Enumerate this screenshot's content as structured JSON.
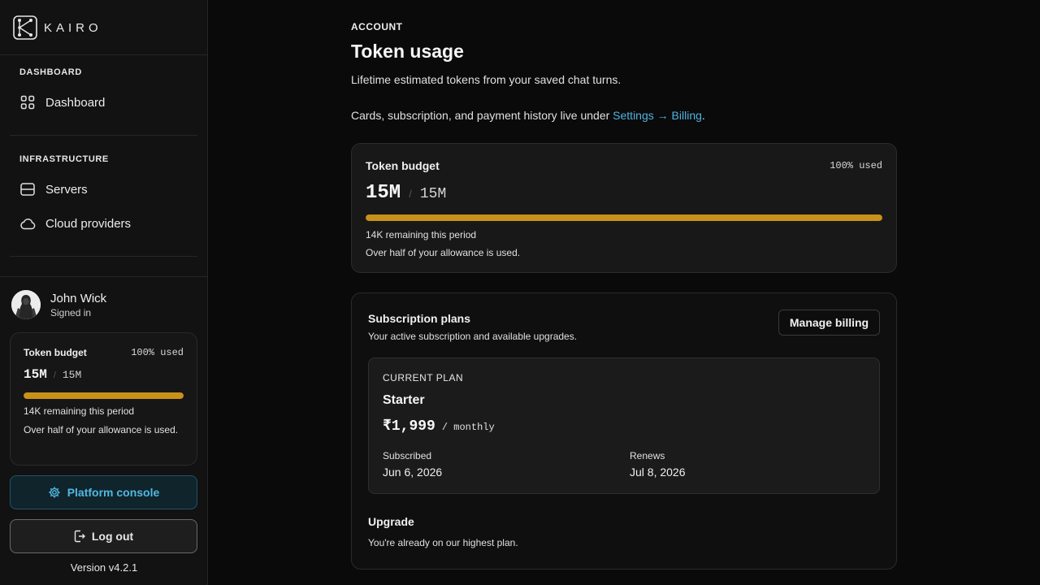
{
  "brand": {
    "name": "KAIRO"
  },
  "sidebar": {
    "sections": [
      {
        "title": "DASHBOARD",
        "items": [
          {
            "label": "Dashboard",
            "icon": "grid-icon"
          }
        ]
      },
      {
        "title": "INFRASTRUCTURE",
        "items": [
          {
            "label": "Servers",
            "icon": "server-icon"
          },
          {
            "label": "Cloud providers",
            "icon": "cloud-icon"
          }
        ]
      }
    ],
    "user": {
      "name": "John Wick",
      "status": "Signed in"
    },
    "budget": {
      "title": "Token budget",
      "percent_label": "100% used",
      "used": "15M",
      "separator": "/",
      "total": "15M",
      "progress": 1.0,
      "remaining": "14K remaining this period",
      "note": "Over half of your allowance is used."
    },
    "console_button": "Platform console",
    "logout_button": "Log out",
    "version": "Version v4.2.1"
  },
  "main": {
    "eyebrow": "ACCOUNT",
    "title": "Token usage",
    "subtitle": "Lifetime estimated tokens from your saved chat turns.",
    "billing_text": "Cards, subscription, and payment history live under",
    "billing_link": "Settings → Billing",
    "billing_end": ".",
    "budget": {
      "title": "Token budget",
      "percent_label": "100% used",
      "used": "15M",
      "separator": "/",
      "total": "15M",
      "progress": 1.0,
      "remaining": "14K remaining this period",
      "note": "Over half of your allowance is used."
    },
    "subscription": {
      "title": "Subscription plans",
      "subtitle": "Your active subscription and available upgrades.",
      "manage_button": "Manage billing",
      "plan": {
        "eyebrow": "CURRENT PLAN",
        "name": "Starter",
        "price": "₹1,999",
        "period": "/ monthly",
        "subscribed_label": "Subscribed",
        "subscribed_value": "Jun 6, 2026",
        "renews_label": "Renews",
        "renews_value": "Jul 8, 2026"
      },
      "upgrade_title": "Upgrade",
      "upgrade_note": "You're already on our highest plan."
    }
  },
  "colors": {
    "accent": "#52b8e0",
    "progress": "#c8911a",
    "background": "#0a0a0a"
  }
}
